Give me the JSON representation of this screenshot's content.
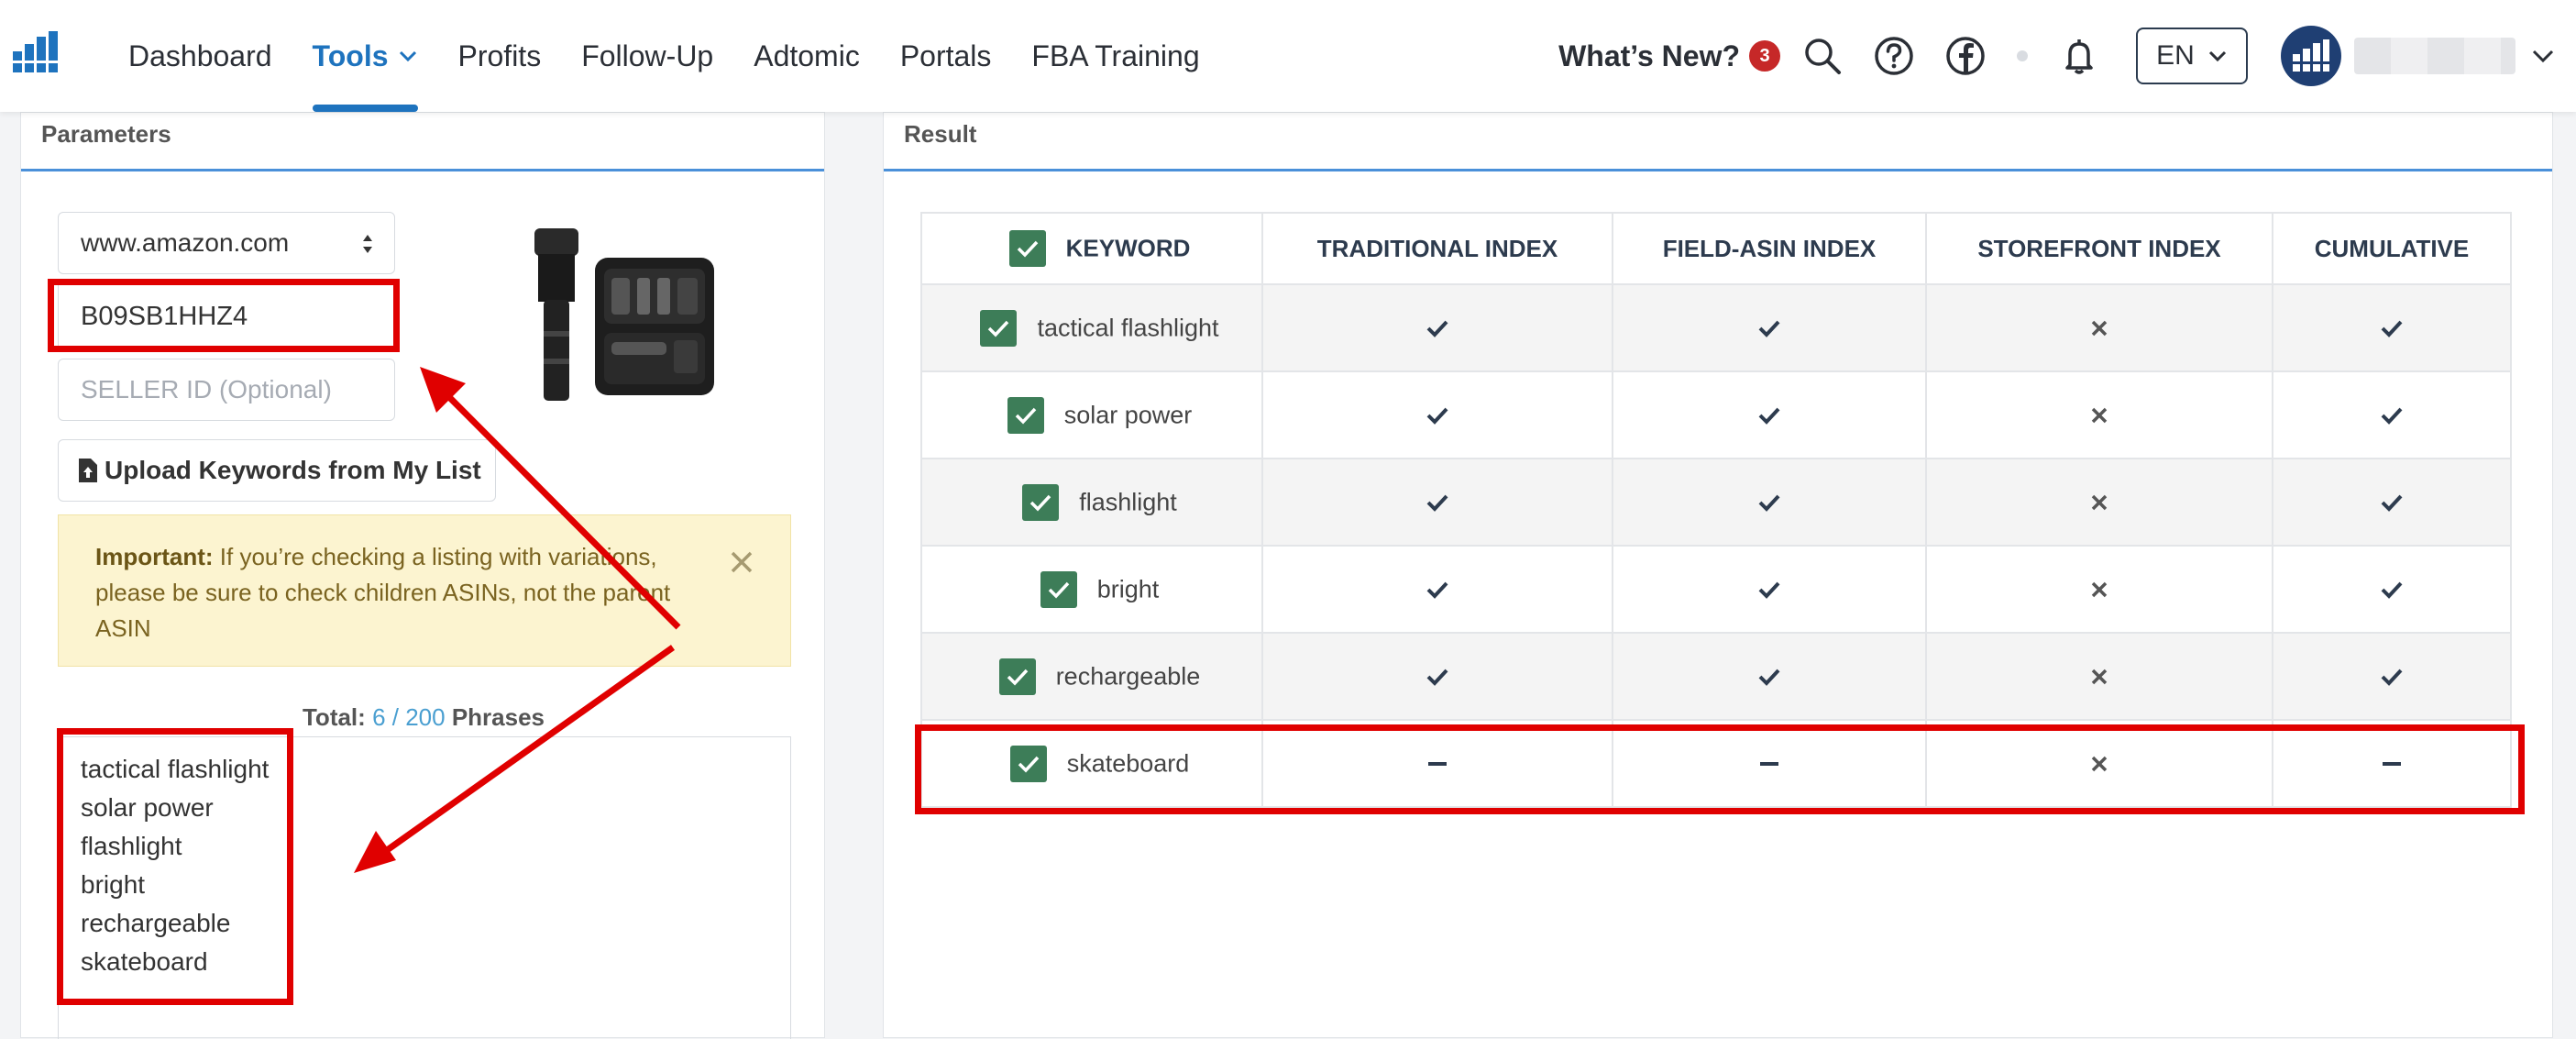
{
  "nav": {
    "items": [
      {
        "label": "Dashboard",
        "active": false
      },
      {
        "label": "Tools",
        "active": true,
        "has_dropdown": true
      },
      {
        "label": "Profits",
        "active": false
      },
      {
        "label": "Follow-Up",
        "active": false
      },
      {
        "label": "Adtomic",
        "active": false
      },
      {
        "label": "Portals",
        "active": false
      },
      {
        "label": "FBA Training",
        "active": false
      }
    ],
    "whats_new": "What’s New?",
    "whats_new_count": "3",
    "language": "EN",
    "icons": [
      "search-icon",
      "help-icon",
      "facebook-icon",
      "bell-icon"
    ]
  },
  "parameters": {
    "title": "Parameters",
    "marketplace": "www.amazon.com",
    "asin": "B09SB1HHZ4",
    "seller_placeholder": "SELLER ID (Optional)",
    "upload_label": "Upload Keywords from My List",
    "alert_bold": "Important:",
    "alert_text": " If you’re checking a listing with variations, please be sure to check children ASINs, not the parent ASIN",
    "total_label": "Total:",
    "total_count": "6 / 200",
    "total_suffix": "Phrases",
    "phrases": [
      "tactical flashlight",
      "solar power",
      "flashlight",
      "bright",
      "rechargeable",
      "skateboard"
    ]
  },
  "result": {
    "title": "Result",
    "columns": [
      "KEYWORD",
      "TRADITIONAL INDEX",
      "FIELD-ASIN INDEX",
      "STOREFRONT INDEX",
      "CUMULATIVE"
    ],
    "rows": [
      {
        "keyword": "tactical flashlight",
        "traditional": "indexed",
        "field_asin": "indexed",
        "storefront": "not-indexed",
        "cumulative": "indexed"
      },
      {
        "keyword": "solar power",
        "traditional": "indexed",
        "field_asin": "indexed",
        "storefront": "not-indexed",
        "cumulative": "indexed"
      },
      {
        "keyword": "flashlight",
        "traditional": "indexed",
        "field_asin": "indexed",
        "storefront": "not-indexed",
        "cumulative": "indexed"
      },
      {
        "keyword": "bright",
        "traditional": "indexed",
        "field_asin": "indexed",
        "storefront": "not-indexed",
        "cumulative": "indexed"
      },
      {
        "keyword": "rechargeable",
        "traditional": "indexed",
        "field_asin": "indexed",
        "storefront": "not-indexed",
        "cumulative": "indexed"
      },
      {
        "keyword": "skateboard",
        "traditional": "none",
        "field_asin": "none",
        "storefront": "not-indexed",
        "cumulative": "none"
      }
    ]
  },
  "colors": {
    "accent": "#1e73be",
    "checkbox": "#3d7d58",
    "highlight": "#e00000",
    "alert_bg": "#fcf4d0"
  }
}
